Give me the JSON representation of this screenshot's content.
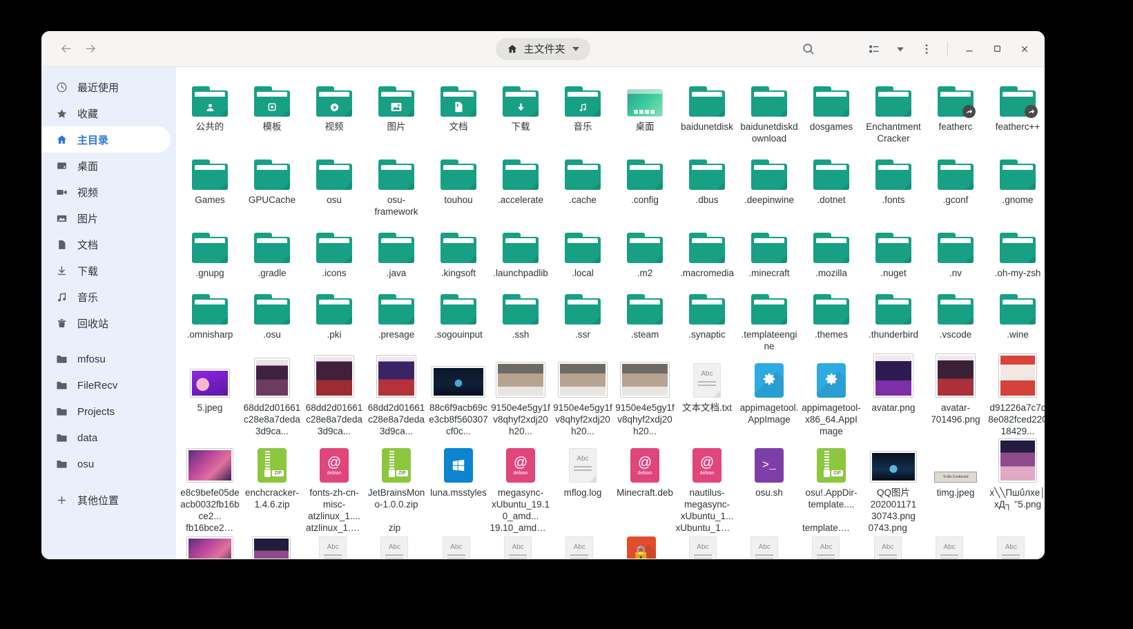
{
  "window": {
    "title": "主文件夹",
    "accent_color": "#2a76d8",
    "folder_color": "#17a083",
    "sidebar_bg": "#e9f0fb"
  },
  "header": {
    "back_label": "后退",
    "forward_label": "前进",
    "path_label": "主文件夹",
    "path_icon": "home-icon",
    "search_label": "搜索",
    "view_label": "视图选项",
    "view_dropdown_label": "视图下拉",
    "menu_label": "主菜单",
    "minimize_label": "最小化",
    "maximize_label": "最大化",
    "close_label": "关闭"
  },
  "sidebar": {
    "items": [
      {
        "label": "最近使用",
        "icon": "clock-icon",
        "active": false
      },
      {
        "label": "收藏",
        "icon": "star-icon",
        "active": false
      },
      {
        "label": "主目录",
        "icon": "home-icon",
        "active": true
      },
      {
        "label": "桌面",
        "icon": "desktop-icon",
        "active": false
      },
      {
        "label": "视频",
        "icon": "video-camera-icon",
        "active": false
      },
      {
        "label": "图片",
        "icon": "image-icon",
        "active": false
      },
      {
        "label": "文档",
        "icon": "document-icon",
        "active": false
      },
      {
        "label": "下载",
        "icon": "download-icon",
        "active": false
      },
      {
        "label": "音乐",
        "icon": "music-note-icon",
        "active": false
      },
      {
        "label": "回收站",
        "icon": "trash-icon",
        "active": false
      }
    ],
    "bookmarks": [
      {
        "label": "mfosu",
        "icon": "folder-icon"
      },
      {
        "label": "FileRecv",
        "icon": "folder-icon"
      },
      {
        "label": "Projects",
        "icon": "folder-icon"
      },
      {
        "label": "data",
        "icon": "folder-icon"
      },
      {
        "label": "osu",
        "icon": "folder-icon"
      }
    ],
    "other_locations": {
      "label": "其他位置",
      "icon": "plus-icon"
    }
  },
  "files": [
    {
      "name": "公共的",
      "type": "folder",
      "emblem": "person-icon"
    },
    {
      "name": "模板",
      "type": "folder",
      "emblem": "template-icon"
    },
    {
      "name": "视频",
      "type": "folder",
      "emblem": "play-icon"
    },
    {
      "name": "图片",
      "type": "folder",
      "emblem": "picture-icon"
    },
    {
      "name": "文档",
      "type": "folder",
      "emblem": "page-icon"
    },
    {
      "name": "下载",
      "type": "folder",
      "emblem": "download-arrow-icon"
    },
    {
      "name": "音乐",
      "type": "folder",
      "emblem": "music-note-icon"
    },
    {
      "name": "桌面",
      "type": "desktop-thumb"
    },
    {
      "name": "baidunetdisk",
      "type": "folder"
    },
    {
      "name": "baidunetdiskdownload",
      "type": "folder"
    },
    {
      "name": "dosgames",
      "type": "folder"
    },
    {
      "name": "EnchantmentCracker",
      "type": "folder"
    },
    {
      "name": "featherc",
      "type": "folder",
      "symlink": true
    },
    {
      "name": "featherc++",
      "type": "folder",
      "symlink": true
    },
    {
      "name": "Games",
      "type": "folder"
    },
    {
      "name": "GPUCache",
      "type": "folder"
    },
    {
      "name": "osu",
      "type": "folder"
    },
    {
      "name": "osu-framework",
      "type": "folder"
    },
    {
      "name": "touhou",
      "type": "folder"
    },
    {
      "name": ".accelerate",
      "type": "folder"
    },
    {
      "name": ".cache",
      "type": "folder"
    },
    {
      "name": ".config",
      "type": "folder"
    },
    {
      "name": ".dbus",
      "type": "folder"
    },
    {
      "name": ".deepinwine",
      "type": "folder"
    },
    {
      "name": ".dotnet",
      "type": "folder"
    },
    {
      "name": ".fonts",
      "type": "folder"
    },
    {
      "name": ".gconf",
      "type": "folder"
    },
    {
      "name": ".gnome",
      "type": "folder"
    },
    {
      "name": ".gnupg",
      "type": "folder"
    },
    {
      "name": ".gradle",
      "type": "folder"
    },
    {
      "name": ".icons",
      "type": "folder"
    },
    {
      "name": ".java",
      "type": "folder"
    },
    {
      "name": ".kingsoft",
      "type": "folder"
    },
    {
      "name": ".launchpadlib",
      "type": "folder"
    },
    {
      "name": ".local",
      "type": "folder"
    },
    {
      "name": ".m2",
      "type": "folder"
    },
    {
      "name": ".macromedia",
      "type": "folder"
    },
    {
      "name": ".minecraft",
      "type": "folder"
    },
    {
      "name": ".mozilla",
      "type": "folder"
    },
    {
      "name": ".nuget",
      "type": "folder"
    },
    {
      "name": ".nv",
      "type": "folder"
    },
    {
      "name": ".oh-my-zsh",
      "type": "folder"
    },
    {
      "name": ".omnisharp",
      "type": "folder"
    },
    {
      "name": ".osu",
      "type": "folder"
    },
    {
      "name": ".pki",
      "type": "folder"
    },
    {
      "name": ".presage",
      "type": "folder"
    },
    {
      "name": ".sogouinput",
      "type": "folder"
    },
    {
      "name": ".ssh",
      "type": "folder"
    },
    {
      "name": ".ssr",
      "type": "folder"
    },
    {
      "name": ".steam",
      "type": "folder"
    },
    {
      "name": ".synaptic",
      "type": "folder"
    },
    {
      "name": ".templateengine",
      "type": "folder"
    },
    {
      "name": ".themes",
      "type": "folder"
    },
    {
      "name": ".thunderbird",
      "type": "folder"
    },
    {
      "name": ".vscode",
      "type": "folder"
    },
    {
      "name": ".wine",
      "type": "folder"
    },
    {
      "name": "5.jpeg",
      "type": "image",
      "thumb": "a1"
    },
    {
      "name": "68dd2d01661c28e8a7deda3d9ca...",
      "type": "image",
      "thumb": "a2"
    },
    {
      "name": "68dd2d01661c28e8a7deda3d9ca...",
      "type": "image",
      "thumb": "a3"
    },
    {
      "name": "68dd2d01661c28e8a7deda3d9ca...",
      "type": "image",
      "thumb": "a4"
    },
    {
      "name": "88c6f9acb69ce3cb8f560307cf0c...",
      "type": "image",
      "thumb": "a5"
    },
    {
      "name": "9150e4e5gy1fv8qhyf2xdj20h20...",
      "type": "image",
      "thumb": "a6"
    },
    {
      "name": "9150e4e5gy1fv8qhyf2xdj20h20...",
      "type": "image",
      "thumb": "a6"
    },
    {
      "name": "9150e4e5gy1fv8qhyf2xdj20h20...",
      "type": "image",
      "thumb": "a6"
    },
    {
      "name": "文本文档.txt",
      "type": "textdoc"
    },
    {
      "name": "appimagetool.AppImage",
      "type": "app",
      "color": "#2eabe2",
      "glyph": "gear-icon"
    },
    {
      "name": "appimagetool-x86_64.AppImage",
      "type": "app",
      "color": "#2eabe2",
      "glyph": "gear-icon"
    },
    {
      "name": "avatar.png",
      "type": "image",
      "thumb": "a7"
    },
    {
      "name": "avatar-701496.png",
      "type": "image",
      "thumb": "a8"
    },
    {
      "name": "d91226a7c7c8e082fced22018429...",
      "type": "image",
      "thumb": "a9"
    },
    {
      "name": "e8c9befe05deacb0032fb16bce2...",
      "type": "image",
      "thumb": "a10"
    },
    {
      "name": "enchcracker-1.4.6.zip",
      "type": "zip"
    },
    {
      "name": "fonts-zh-cn-misc-atzlinux_1....",
      "type": "deb"
    },
    {
      "name": "JetBrainsMono-1.0.0.zip",
      "type": "zip"
    },
    {
      "name": "luna.msstyles",
      "type": "windows"
    },
    {
      "name": "megasync-xUbuntu_19.10_amd...",
      "type": "deb"
    },
    {
      "name": "mflog.log",
      "type": "textdoc"
    },
    {
      "name": "Minecraft.deb",
      "type": "deb"
    },
    {
      "name": "nautilus-megasync-xUbuntu_1...",
      "type": "deb"
    },
    {
      "name": "osu.sh",
      "type": "shell"
    },
    {
      "name": "osu!.AppDir-template....",
      "type": "zip"
    },
    {
      "name": "QQ图片202001171 30743.png",
      "type": "image",
      "thumb": "a12"
    },
    {
      "name": "timg.jpeg",
      "type": "timg"
    },
    {
      "name": "x╲╲Пшΰлхе│хД┐ ''5.png",
      "type": "image",
      "thumb": "a11"
    }
  ],
  "partial_row": {
    "labels_top": [
      "fb16bce2…",
      "",
      "atzlinux_1.…",
      "zip",
      "",
      "19.10_amd…",
      "",
      "",
      "xUbuntu_1…",
      "",
      "template.…",
      "0743.png",
      "",
      ""
    ],
    "items": [
      {
        "type": "image",
        "thumb": "a10"
      },
      {
        "type": "image",
        "thumb": "a11"
      },
      {
        "type": "textdoc"
      },
      {
        "type": "textdoc"
      },
      {
        "type": "textdoc"
      },
      {
        "type": "textdoc"
      },
      {
        "type": "textdoc"
      },
      {
        "type": "archive-locked"
      },
      {
        "type": "textdoc"
      },
      {
        "type": "textdoc"
      },
      {
        "type": "textdoc"
      },
      {
        "type": "textdoc"
      },
      {
        "type": "textdoc"
      },
      {
        "type": "textdoc"
      }
    ]
  }
}
